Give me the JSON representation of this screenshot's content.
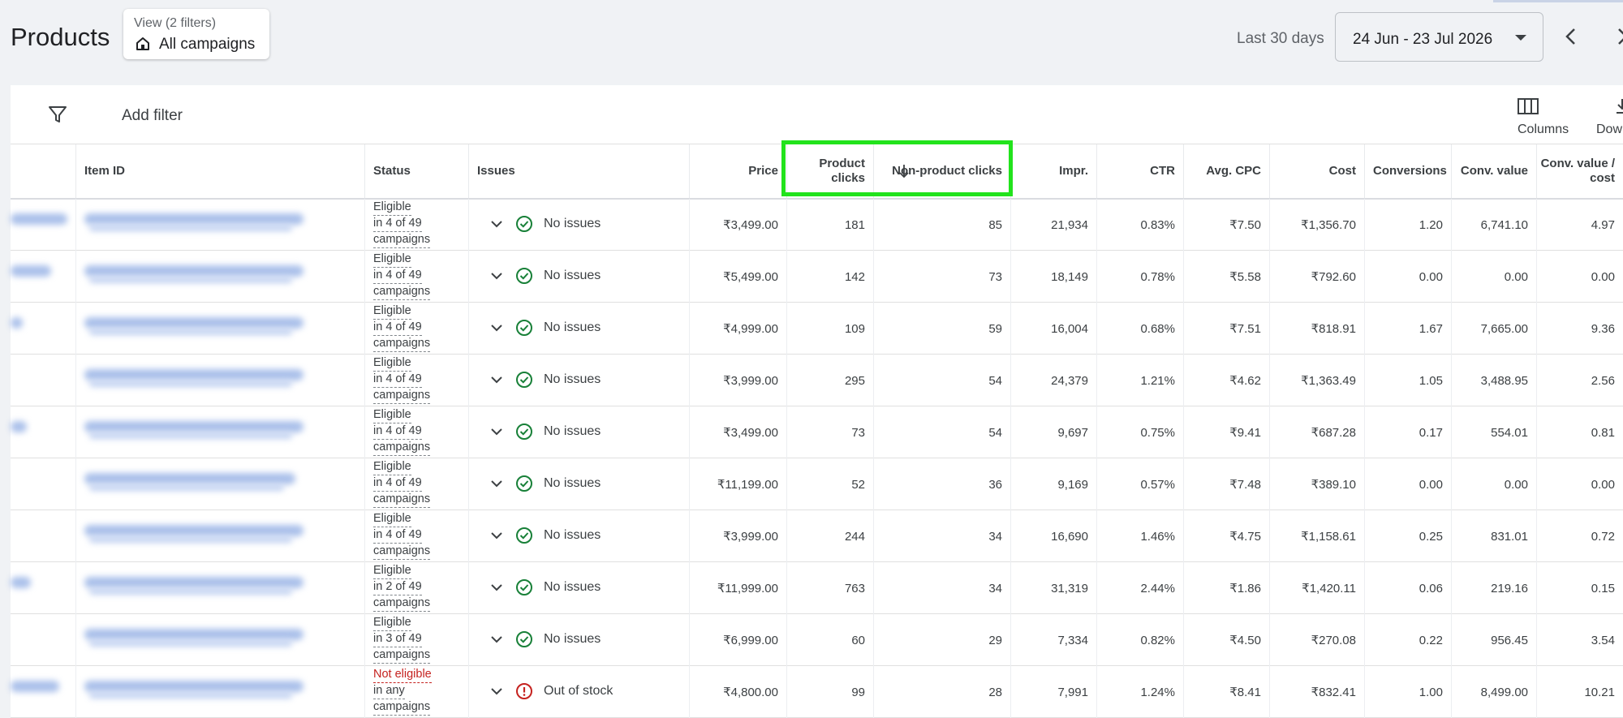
{
  "page": {
    "title": "Products",
    "view": {
      "label": "View (2 filters)",
      "value": "All campaigns"
    },
    "date_label": "Last 30 days",
    "date_range": "24 Jun - 23 Jul 2026"
  },
  "toolbar": {
    "add_filter": "Add filter",
    "columns": "Columns",
    "download": "Dow"
  },
  "table": {
    "headers": {
      "item_id": "Item ID",
      "status": "Status",
      "issues": "Issues",
      "price": "Price",
      "product_clicks": "Product clicks",
      "non_product_clicks": "Non-product clicks",
      "impr": "Impr.",
      "ctr": "CTR",
      "avg_cpc": "Avg. CPC",
      "cost": "Cost",
      "conversions": "Conversions",
      "conv_value": "Conv. value",
      "conv_value_cost": "Conv. value / cost"
    },
    "sort": {
      "column": "Non-product clicks",
      "direction": "descending"
    },
    "rows": [
      {
        "status": "Eligible",
        "status_detail_1": "in 4 of 49",
        "status_detail_2": "campaigns",
        "issue": "No issues",
        "price": "₹3,499.00",
        "product_clicks": "181",
        "non_product_clicks": "85",
        "impr": "21,934",
        "ctr": "0.83%",
        "avg_cpc": "₹7.50",
        "cost": "₹1,356.70",
        "conversions": "1.20",
        "conv_value": "6,741.10",
        "conv_value_cost": "4.97"
      },
      {
        "status": "Eligible",
        "status_detail_1": "in 4 of 49",
        "status_detail_2": "campaigns",
        "issue": "No issues",
        "price": "₹5,499.00",
        "product_clicks": "142",
        "non_product_clicks": "73",
        "impr": "18,149",
        "ctr": "0.78%",
        "avg_cpc": "₹5.58",
        "cost": "₹792.60",
        "conversions": "0.00",
        "conv_value": "0.00",
        "conv_value_cost": "0.00"
      },
      {
        "status": "Eligible",
        "status_detail_1": "in 4 of 49",
        "status_detail_2": "campaigns",
        "issue": "No issues",
        "price": "₹4,999.00",
        "product_clicks": "109",
        "non_product_clicks": "59",
        "impr": "16,004",
        "ctr": "0.68%",
        "avg_cpc": "₹7.51",
        "cost": "₹818.91",
        "conversions": "1.67",
        "conv_value": "7,665.00",
        "conv_value_cost": "9.36"
      },
      {
        "status": "Eligible",
        "status_detail_1": "in 4 of 49",
        "status_detail_2": "campaigns",
        "issue": "No issues",
        "price": "₹3,999.00",
        "product_clicks": "295",
        "non_product_clicks": "54",
        "impr": "24,379",
        "ctr": "1.21%",
        "avg_cpc": "₹4.62",
        "cost": "₹1,363.49",
        "conversions": "1.05",
        "conv_value": "3,488.95",
        "conv_value_cost": "2.56"
      },
      {
        "status": "Eligible",
        "status_detail_1": "in 4 of 49",
        "status_detail_2": "campaigns",
        "issue": "No issues",
        "price": "₹3,499.00",
        "product_clicks": "73",
        "non_product_clicks": "54",
        "impr": "9,697",
        "ctr": "0.75%",
        "avg_cpc": "₹9.41",
        "cost": "₹687.28",
        "conversions": "0.17",
        "conv_value": "554.01",
        "conv_value_cost": "0.81"
      },
      {
        "status": "Eligible",
        "status_detail_1": "in 4 of 49",
        "status_detail_2": "campaigns",
        "issue": "No issues",
        "price": "₹11,199.00",
        "product_clicks": "52",
        "non_product_clicks": "36",
        "impr": "9,169",
        "ctr": "0.57%",
        "avg_cpc": "₹7.48",
        "cost": "₹389.10",
        "conversions": "0.00",
        "conv_value": "0.00",
        "conv_value_cost": "0.00"
      },
      {
        "status": "Eligible",
        "status_detail_1": "in 4 of 49",
        "status_detail_2": "campaigns",
        "issue": "No issues",
        "price": "₹3,999.00",
        "product_clicks": "244",
        "non_product_clicks": "34",
        "impr": "16,690",
        "ctr": "1.46%",
        "avg_cpc": "₹4.75",
        "cost": "₹1,158.61",
        "conversions": "0.25",
        "conv_value": "831.01",
        "conv_value_cost": "0.72"
      },
      {
        "status": "Eligible",
        "status_detail_1": "in 2 of 49",
        "status_detail_2": "campaigns",
        "issue": "No issues",
        "price": "₹11,999.00",
        "product_clicks": "763",
        "non_product_clicks": "34",
        "impr": "31,319",
        "ctr": "2.44%",
        "avg_cpc": "₹1.86",
        "cost": "₹1,420.11",
        "conversions": "0.06",
        "conv_value": "219.16",
        "conv_value_cost": "0.15"
      },
      {
        "status": "Eligible",
        "status_detail_1": "in 3 of 49",
        "status_detail_2": "campaigns",
        "issue": "No issues",
        "price": "₹6,999.00",
        "product_clicks": "60",
        "non_product_clicks": "29",
        "impr": "7,334",
        "ctr": "0.82%",
        "avg_cpc": "₹4.50",
        "cost": "₹270.08",
        "conversions": "0.22",
        "conv_value": "956.45",
        "conv_value_cost": "3.54"
      },
      {
        "status": "Not eligible",
        "status_detail_1": "in any",
        "status_detail_2": "campaigns",
        "issue": "Out of stock",
        "price": "₹4,800.00",
        "product_clicks": "99",
        "non_product_clicks": "28",
        "impr": "7,991",
        "ctr": "1.24%",
        "avg_cpc": "₹8.41",
        "cost": "₹832.41",
        "conversions": "1.00",
        "conv_value": "8,499.00",
        "conv_value_cost": "10.21"
      }
    ]
  },
  "colors": {
    "highlight": "#22e31c",
    "ok": "#188038",
    "error": "#c5221f",
    "background": "#f0f2f5"
  },
  "icons": {
    "view": "home-icon",
    "date": "caret-down-icon",
    "filter": "filter-icon",
    "columns": "columns-icon",
    "download": "download-icon",
    "ok": "check-circle-icon",
    "error": "alert-circle-icon"
  }
}
